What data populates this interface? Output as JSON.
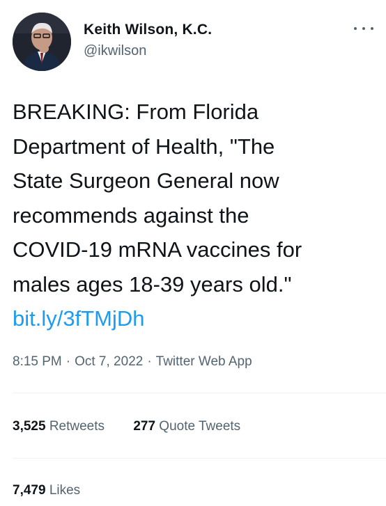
{
  "author": {
    "display_name": "Keith Wilson, K.C.",
    "handle": "@ikwilson"
  },
  "tweet": {
    "lines": [
      "BREAKING:  From Florida",
      "Department of Health, \"The",
      "State Surgeon General now",
      "recommends against the",
      "COVID-19 mRNA vaccines for",
      "males ages 18-39 years old.\""
    ],
    "link": "bit.ly/3fTMjDh"
  },
  "meta": {
    "time": "8:15 PM",
    "separator": "·",
    "date": "Oct 7, 2022",
    "source": "Twitter Web App"
  },
  "stats": {
    "retweets": {
      "count": "3,525",
      "label": "Retweets"
    },
    "quote_tweets": {
      "count": "277",
      "label": "Quote Tweets"
    },
    "likes": {
      "count": "7,479",
      "label": "Likes"
    }
  },
  "colors": {
    "link": "#1d9bf0",
    "secondary_text": "#536471",
    "primary_text": "#0f1419",
    "divider": "#eff3f4"
  },
  "icons": [
    "more-icon"
  ]
}
